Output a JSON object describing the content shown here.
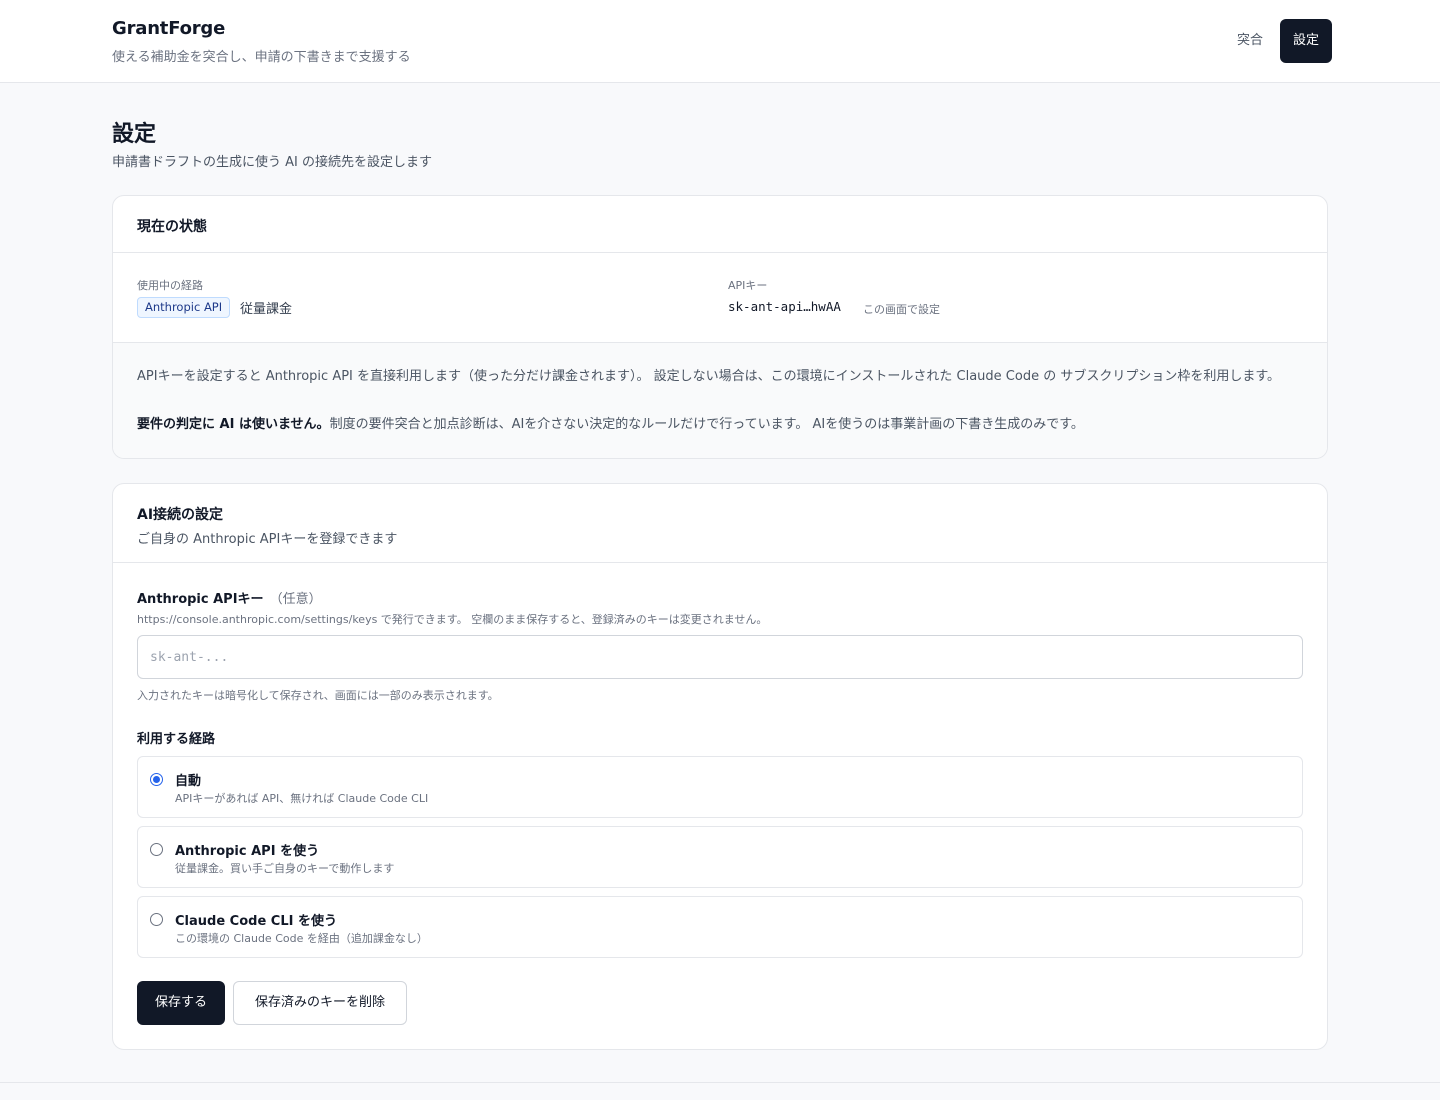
{
  "header": {
    "brand": "GrantForge",
    "tagline": "使える補助金を突合し、申請の下書きまで支援する",
    "nav": {
      "match_label": "突合",
      "settings_label": "設定"
    }
  },
  "page": {
    "title": "設定",
    "subtitle": "申請書ドラフトの生成に使う AI の接続先を設定します"
  },
  "status_card": {
    "title": "現在の状態",
    "route_label": "使用中の経路",
    "route_badge": "Anthropic API",
    "route_billing": "従量課金",
    "api_key_label": "APIキー",
    "api_key_value": "sk-ant-api…hwAA",
    "api_key_note": "この画面で設定",
    "info_p1": "APIキーを設定すると Anthropic API を直接利用します（使った分だけ課金されます）。 設定しない場合は、この環境にインストールされた Claude Code の サブスクリプション枠を利用します。",
    "info_p2_bold": "要件の判定に AI は使いません。",
    "info_p2_rest": "制度の要件突合と加点診断は、AIを介さない決定的なルールだけで行っています。 AIを使うのは事業計画の下書き生成のみです。"
  },
  "ai_card": {
    "title": "AI接続の設定",
    "subtitle": "ご自身の Anthropic APIキーを登録できます",
    "key_field": {
      "label": "Anthropic APIキー",
      "optional": "（任意）",
      "help": "https://console.anthropic.com/settings/keys で発行できます。 空欄のまま保存すると、登録済みのキーは変更されません。",
      "value": "",
      "placeholder": "sk-ant-...",
      "note": "入力されたキーは暗号化して保存され、画面には一部のみ表示されます。"
    },
    "route_label": "利用する経路",
    "options": [
      {
        "title": "自動",
        "desc": "APIキーがあれば API、無ければ Claude Code CLI",
        "checked": true
      },
      {
        "title": "Anthropic API を使う",
        "desc": "従量課金。買い手ご自身のキーで動作します",
        "checked": false
      },
      {
        "title": "Claude Code CLI を使う",
        "desc": "この環境の Claude Code を経由（追加課金なし）",
        "checked": false
      }
    ],
    "save_label": "保存する",
    "delete_label": "保存済みのキーを削除"
  }
}
